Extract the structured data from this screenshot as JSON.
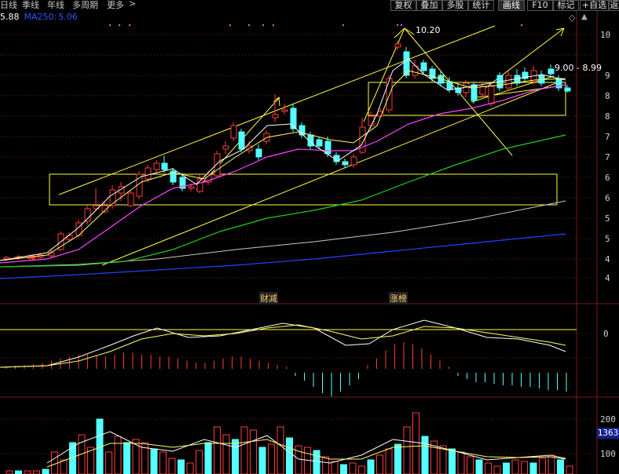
{
  "toolbar": {
    "tabs": [
      "日线",
      "季线",
      "年线",
      "多周期",
      "更多"
    ],
    "right_buttons": [
      "复权",
      "叠加",
      "多股",
      "统计",
      "画线",
      "F10",
      "标记",
      "+自选",
      "返"
    ],
    "active_button": "画线"
  },
  "legend": {
    "prefix_value": "5.88",
    "ma_label": "MA250:",
    "ma_value": "5.06"
  },
  "annotations": {
    "peak_label": "10.20",
    "range_label": "9.00 - 8.99",
    "event_caijian": "财减",
    "event_zhangbang": "涨榜"
  },
  "price_axis": {
    "ticks": [
      "10",
      "9",
      "8",
      "8",
      "7",
      "7",
      "6",
      "6",
      "5",
      "5",
      "4",
      "4"
    ]
  },
  "macd_axis": {
    "ticks": [
      "0"
    ]
  },
  "volume_axis": {
    "ticks": [
      "200",
      "100"
    ],
    "current_volume": "1363"
  },
  "colors": {
    "up": "#ff3b3b",
    "down": "#54ffff",
    "ma5": "#ffffff",
    "ma10": "#ffff66",
    "ma20": "#ff44ff",
    "ma60": "#22cc22",
    "ma120": "#c8c8c8",
    "ma250": "#2244ff",
    "annotation_line": "#ffff40",
    "accent": "#ff44ff"
  }
}
